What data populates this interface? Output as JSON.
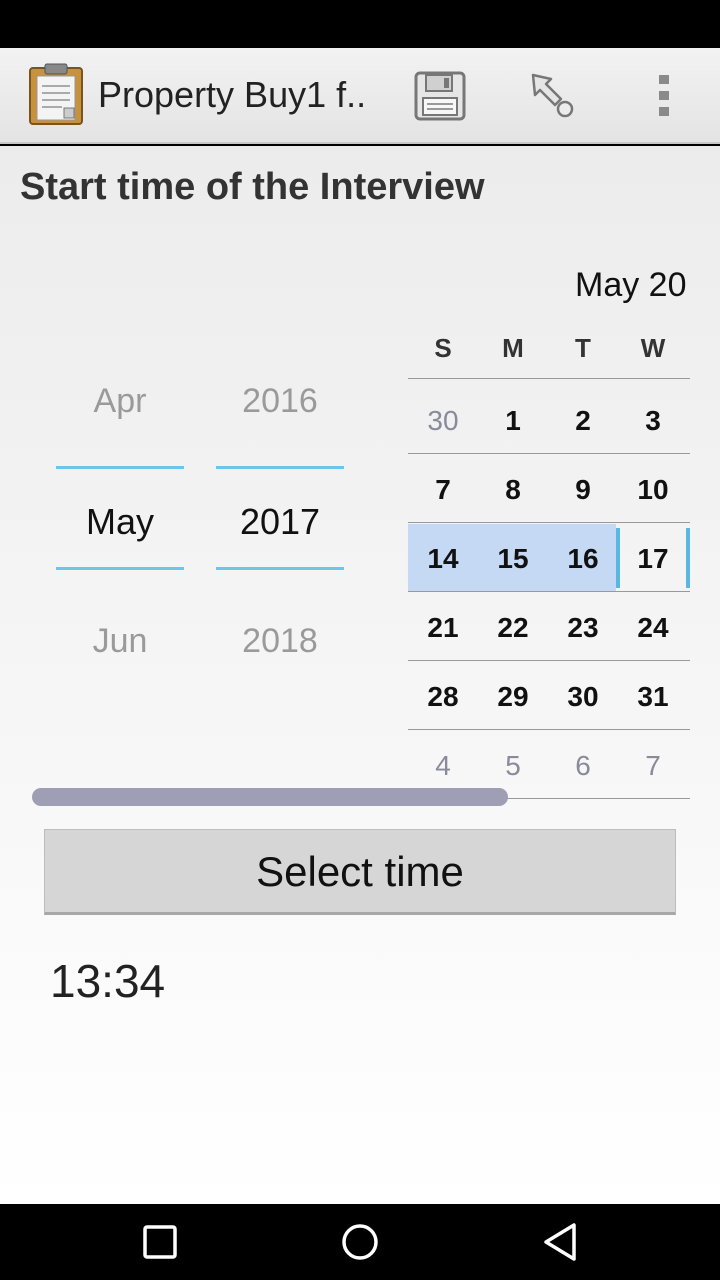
{
  "app": {
    "title": "Property Buy1 f.."
  },
  "toolbar": {
    "save_icon": "save-icon",
    "goto_icon": "goto-icon",
    "overflow_icon": "overflow-menu-icon"
  },
  "question": {
    "label": "Start time of the Interview"
  },
  "date_picker": {
    "month_spinner": {
      "prev": "Apr",
      "current": "May",
      "next": "Jun"
    },
    "year_spinner": {
      "prev": "2016",
      "current": "2017",
      "next": "2018"
    },
    "calendar": {
      "month_title": "May 20",
      "weekday_headers": [
        "S",
        "M",
        "T",
        "W"
      ],
      "weeks": [
        [
          "30",
          "1",
          "2",
          "3"
        ],
        [
          "7",
          "8",
          "9",
          "10"
        ],
        [
          "14",
          "15",
          "16",
          "17"
        ],
        [
          "21",
          "22",
          "23",
          "24"
        ],
        [
          "28",
          "29",
          "30",
          "31"
        ],
        [
          "4",
          "5",
          "6",
          "7"
        ]
      ],
      "highlighted_week_index": 2,
      "selected_day": "17"
    }
  },
  "time_picker": {
    "button_label": "Select time",
    "value": "13:34"
  },
  "colors": {
    "accent": "#6ec6e6",
    "week_highlight": "#c5d9f4",
    "scrollbar": "#9e9eb4"
  },
  "navigation": {
    "back_icon": "back-icon",
    "home_icon": "home-icon",
    "recents_icon": "recents-icon"
  }
}
